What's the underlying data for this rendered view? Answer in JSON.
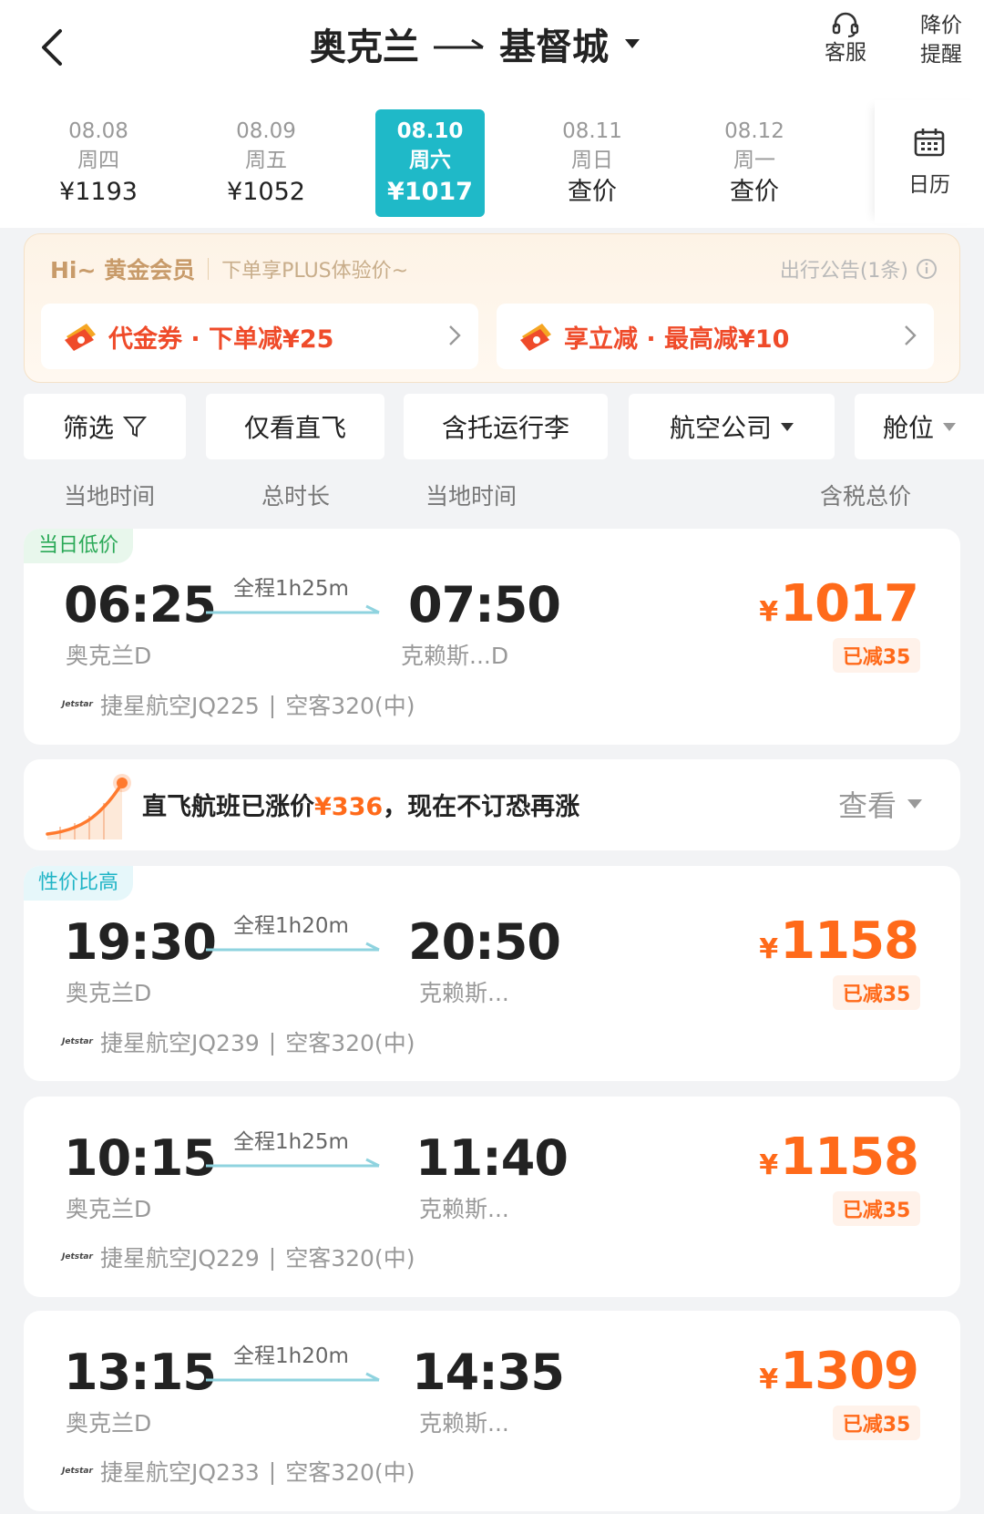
{
  "header": {
    "origin": "奥克兰",
    "destination": "基督城",
    "service_label": "客服",
    "alert_label_1": "降价",
    "alert_label_2": "提醒"
  },
  "dates": [
    {
      "date": "08.08",
      "weekday": "周四",
      "price": "¥1193",
      "active": false
    },
    {
      "date": "08.09",
      "weekday": "周五",
      "price": "¥1052",
      "active": false
    },
    {
      "date": "08.10",
      "weekday": "周六",
      "price": "¥1017",
      "active": true
    },
    {
      "date": "08.11",
      "weekday": "周日",
      "price": "查价",
      "active": false
    },
    {
      "date": "08.12",
      "weekday": "周一",
      "price": "查价",
      "active": false
    }
  ],
  "calendar_label": "日历",
  "promo": {
    "level": "Hi~ 黄金会员",
    "subtitle": "下单享PLUS体验价~",
    "notice": "出行公告(1条)",
    "coupon_left": "代金券 · 下单减¥25",
    "coupon_right": "享立减 · 最高减¥10"
  },
  "filters": {
    "filter": "筛选",
    "direct": "仅看直飞",
    "baggage": "含托运行李",
    "airline": "航空公司",
    "cabin": "舱位"
  },
  "columns": {
    "dep_time": "当地时间",
    "duration": "总时长",
    "arr_time": "当地时间",
    "price": "含税总价"
  },
  "flights": [
    {
      "tag": "当日低价",
      "dep_time": "06:25",
      "dep_airport": "奥克兰D",
      "duration": "全程1h25m",
      "arr_time": "07:50",
      "arr_airport": "克赖斯...D",
      "airline": "捷星航空JQ225",
      "aircraft": "空客320(中)",
      "currency": "¥",
      "price": "1017",
      "discount": "已减35"
    },
    {
      "tag": "性价比高",
      "dep_time": "19:30",
      "dep_airport": "奥克兰D",
      "duration": "全程1h20m",
      "arr_time": "20:50",
      "arr_airport": "克赖斯...",
      "airline": "捷星航空JQ239",
      "aircraft": "空客320(中)",
      "currency": "¥",
      "price": "1158",
      "discount": "已减35"
    },
    {
      "tag": "",
      "dep_time": "10:15",
      "dep_airport": "奥克兰D",
      "duration": "全程1h25m",
      "arr_time": "11:40",
      "arr_airport": "克赖斯...",
      "airline": "捷星航空JQ229",
      "aircraft": "空客320(中)",
      "currency": "¥",
      "price": "1158",
      "discount": "已减35"
    },
    {
      "tag": "",
      "dep_time": "13:15",
      "dep_airport": "奥克兰D",
      "duration": "全程1h20m",
      "arr_time": "14:35",
      "arr_airport": "克赖斯...",
      "airline": "捷星航空JQ233",
      "aircraft": "空客320(中)",
      "currency": "¥",
      "price": "1309",
      "discount": "已减35"
    }
  ],
  "price_alert": {
    "text_prefix": "直飞航班已涨价",
    "amount": "¥336",
    "text_suffix": "，现在不订恐再涨",
    "view_label": "查看"
  },
  "airline_separator": "|",
  "colors": {
    "accent_teal": "#1fb9c8",
    "price_orange": "#ff6a1a",
    "coupon_red": "#ef4b2a",
    "tag_green": "#2aa957",
    "gold": "#c89b6a"
  }
}
